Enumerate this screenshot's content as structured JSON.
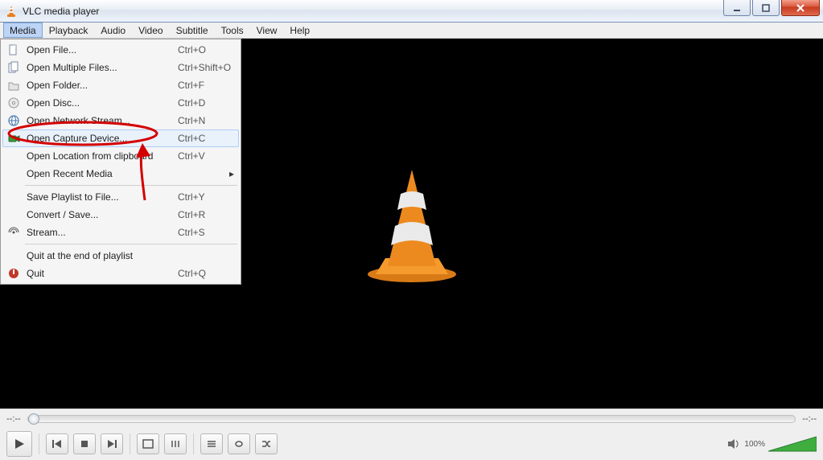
{
  "window": {
    "title": "VLC media player"
  },
  "menubar": {
    "items": [
      "Media",
      "Playback",
      "Audio",
      "Video",
      "Subtitle",
      "Tools",
      "View",
      "Help"
    ],
    "active_index": 0
  },
  "media_menu": {
    "items": [
      {
        "icon": "file",
        "label": "Open File...",
        "shortcut": "Ctrl+O"
      },
      {
        "icon": "files",
        "label": "Open Multiple Files...",
        "shortcut": "Ctrl+Shift+O"
      },
      {
        "icon": "folder",
        "label": "Open Folder...",
        "shortcut": "Ctrl+F"
      },
      {
        "icon": "disc",
        "label": "Open Disc...",
        "shortcut": "Ctrl+D"
      },
      {
        "icon": "network",
        "label": "Open Network Stream...",
        "shortcut": "Ctrl+N"
      },
      {
        "icon": "capture",
        "label": "Open Capture Device...",
        "shortcut": "Ctrl+C",
        "highlight": true
      },
      {
        "icon": "",
        "label": "Open Location from clipboard",
        "shortcut": "Ctrl+V"
      },
      {
        "icon": "",
        "label": "Open Recent Media",
        "shortcut": "",
        "submenu": true
      },
      {
        "sep": true
      },
      {
        "icon": "",
        "label": "Save Playlist to File...",
        "shortcut": "Ctrl+Y"
      },
      {
        "icon": "",
        "label": "Convert / Save...",
        "shortcut": "Ctrl+R"
      },
      {
        "icon": "stream",
        "label": "Stream...",
        "shortcut": "Ctrl+S"
      },
      {
        "sep": true
      },
      {
        "icon": "",
        "label": "Quit at the end of playlist",
        "shortcut": ""
      },
      {
        "icon": "quit",
        "label": "Quit",
        "shortcut": "Ctrl+Q"
      }
    ]
  },
  "playback": {
    "time_left": "--:--",
    "time_right": "--:--",
    "volume_label": "100%"
  }
}
